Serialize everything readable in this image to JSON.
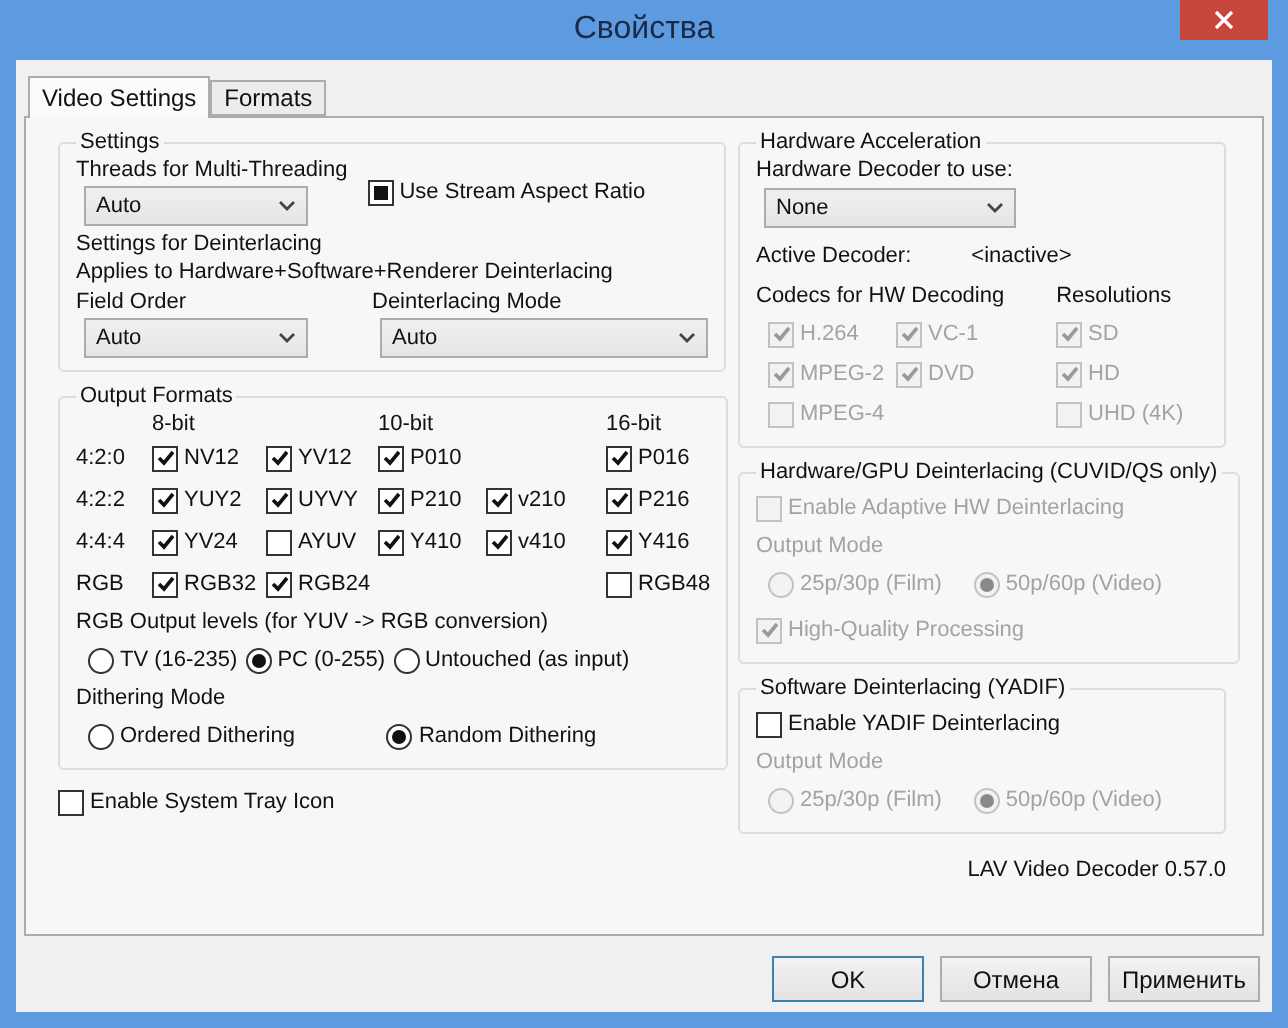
{
  "window": {
    "title": "Свойства"
  },
  "tabs": [
    {
      "label": "Video Settings",
      "selected": true
    },
    {
      "label": "Formats",
      "selected": false
    }
  ],
  "settings": {
    "title": "Settings",
    "threads_label": "Threads for Multi-Threading",
    "threads_value": "Auto",
    "stream_aspect": {
      "label": "Use Stream Aspect Ratio",
      "indeterminate": true
    },
    "deint_heading": "Settings for Deinterlacing",
    "deint_note": "Applies to Hardware+Software+Renderer Deinterlacing",
    "field_order_label": "Field Order",
    "field_order_value": "Auto",
    "deint_mode_label": "Deinterlacing Mode",
    "deint_mode_value": "Auto"
  },
  "output_formats": {
    "title": "Output Formats",
    "columns": [
      "8-bit",
      null,
      "10-bit",
      null,
      "16-bit"
    ],
    "rows": [
      {
        "label": "4:2:0",
        "cells": [
          {
            "label": "NV12",
            "checked": true
          },
          {
            "label": "YV12",
            "checked": true
          },
          {
            "label": "P010",
            "checked": true
          },
          null,
          {
            "label": "P016",
            "checked": true
          }
        ]
      },
      {
        "label": "4:2:2",
        "cells": [
          {
            "label": "YUY2",
            "checked": true
          },
          {
            "label": "UYVY",
            "checked": true
          },
          {
            "label": "P210",
            "checked": true
          },
          {
            "label": "v210",
            "checked": true
          },
          {
            "label": "P216",
            "checked": true
          }
        ]
      },
      {
        "label": "4:4:4",
        "cells": [
          {
            "label": "YV24",
            "checked": true
          },
          {
            "label": "AYUV",
            "checked": false
          },
          {
            "label": "Y410",
            "checked": true
          },
          {
            "label": "v410",
            "checked": true
          },
          {
            "label": "Y416",
            "checked": true
          }
        ]
      },
      {
        "label": "RGB",
        "cells": [
          {
            "label": "RGB32",
            "checked": true
          },
          {
            "label": "RGB24",
            "checked": true
          },
          null,
          null,
          {
            "label": "RGB48",
            "checked": false
          }
        ]
      }
    ],
    "rgb_levels": {
      "title": "RGB Output levels (for YUV -> RGB conversion)",
      "options": [
        {
          "label": "TV (16-235)",
          "selected": false
        },
        {
          "label": "PC (0-255)",
          "selected": true
        },
        {
          "label": "Untouched (as input)",
          "selected": false
        }
      ]
    },
    "dithering": {
      "title": "Dithering Mode",
      "options": [
        {
          "label": "Ordered Dithering",
          "selected": false
        },
        {
          "label": "Random Dithering",
          "selected": true
        }
      ]
    }
  },
  "tray": {
    "label": "Enable System Tray Icon",
    "checked": false
  },
  "hw": {
    "title": "Hardware Acceleration",
    "decoder_label": "Hardware Decoder to use:",
    "decoder_value": "None",
    "active_label": "Active Decoder:",
    "active_value": "<inactive>",
    "codecs_label": "Codecs for HW Decoding",
    "resolutions_label": "Resolutions",
    "codecs": [
      {
        "label": "H.264",
        "checked": true,
        "disabled": true
      },
      {
        "label": "VC-1",
        "checked": true,
        "disabled": true
      },
      {
        "label": "MPEG-2",
        "checked": true,
        "disabled": true
      },
      {
        "label": "DVD",
        "checked": true,
        "disabled": true
      },
      {
        "label": "MPEG-4",
        "checked": false,
        "disabled": true
      }
    ],
    "resolutions": [
      {
        "label": "SD",
        "checked": true,
        "disabled": true
      },
      {
        "label": "HD",
        "checked": true,
        "disabled": true
      },
      {
        "label": "UHD (4K)",
        "checked": false,
        "disabled": true
      }
    ]
  },
  "gpu_deint": {
    "title": "Hardware/GPU Deinterlacing (CUVID/QS only)",
    "enable": {
      "label": "Enable Adaptive HW Deinterlacing",
      "checked": false,
      "disabled": true
    },
    "mode_label": "Output Mode",
    "modes": [
      {
        "label": "25p/30p (Film)",
        "selected": false,
        "disabled": true
      },
      {
        "label": "50p/60p (Video)",
        "selected": true,
        "disabled": true
      }
    ],
    "hq": {
      "label": "High-Quality Processing",
      "checked": true,
      "disabled": true
    }
  },
  "sw_deint": {
    "title": "Software Deinterlacing (YADIF)",
    "enable": {
      "label": "Enable YADIF Deinterlacing",
      "checked": false,
      "disabled": false
    },
    "mode_label": "Output Mode",
    "modes": [
      {
        "label": "25p/30p (Film)",
        "selected": false,
        "disabled": true
      },
      {
        "label": "50p/60p (Video)",
        "selected": true,
        "disabled": true
      }
    ]
  },
  "version": "LAV Video Decoder 0.57.0",
  "buttons": [
    {
      "label": "OK",
      "default": true
    },
    {
      "label": "Отмена",
      "default": false
    },
    {
      "label": "Применить",
      "default": false
    }
  ]
}
